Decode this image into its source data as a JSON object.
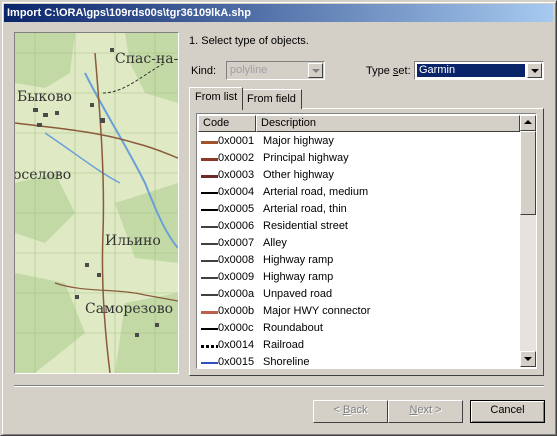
{
  "window": {
    "title": "Import C:\\ORA\\gps\\109rds00s\\tgr36109lkA.shp"
  },
  "map": {
    "labels": [
      "Спас-на-",
      "Быково",
      "оселово",
      "Ильино",
      "Саморезово"
    ]
  },
  "step": {
    "text": "1. Select type of objects."
  },
  "kind": {
    "label": "Kind:",
    "value": "polyline"
  },
  "typeset": {
    "label_before": "Type ",
    "label_underlined": "s",
    "label_after": "et:",
    "value": "Garmin"
  },
  "tabs": [
    {
      "label": "From list",
      "active": true
    },
    {
      "label": "From field",
      "active": false
    }
  ],
  "list": {
    "headers": [
      "Code",
      "Description"
    ],
    "rows": [
      {
        "code": "0x0001",
        "description": "Major highway",
        "swatch": "#a0522d"
      },
      {
        "code": "0x0002",
        "description": "Principal highway",
        "swatch": "#8b3a2a"
      },
      {
        "code": "0x0003",
        "description": "Other highway",
        "swatch": "#6b2b2b"
      },
      {
        "code": "0x0004",
        "description": "Arterial road, medium",
        "swatch": "#000000"
      },
      {
        "code": "0x0005",
        "description": "Arterial road, thin",
        "swatch": "#000000"
      },
      {
        "code": "0x0006",
        "description": "Residential street",
        "swatch": "#404040"
      },
      {
        "code": "0x0007",
        "description": "Alley",
        "swatch": "#404040"
      },
      {
        "code": "0x0008",
        "description": "Highway ramp",
        "swatch": "#404040"
      },
      {
        "code": "0x0009",
        "description": "Highway ramp",
        "swatch": "#404040"
      },
      {
        "code": "0x000a",
        "description": "Unpaved road",
        "swatch": "#404040"
      },
      {
        "code": "0x000b",
        "description": "Major HWY connector",
        "swatch": "#c0604a"
      },
      {
        "code": "0x000c",
        "description": "Roundabout",
        "swatch": "#000000"
      },
      {
        "code": "0x0014",
        "description": "Railroad",
        "swatch": "#000000"
      },
      {
        "code": "0x0015",
        "description": "Shoreline",
        "swatch": "#3050c0"
      }
    ]
  },
  "buttons": {
    "back": {
      "label_prefix": "< ",
      "underlined": "B",
      "label_rest": "ack"
    },
    "next": {
      "underlined": "N",
      "label_rest": "ext >"
    },
    "cancel": "Cancel"
  }
}
